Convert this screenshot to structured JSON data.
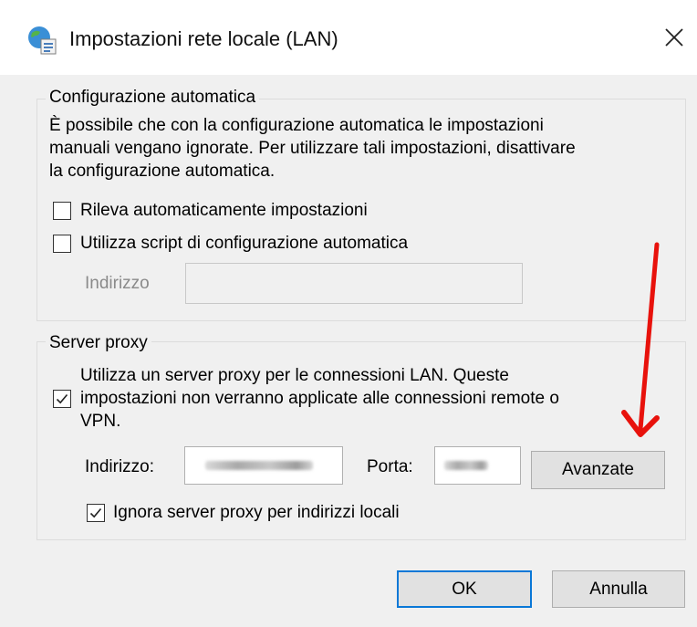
{
  "window": {
    "title": "Impostazioni rete locale (LAN)",
    "icon": "network-globe-icon",
    "close_glyph": "✕"
  },
  "auto_config": {
    "legend": "Configurazione automatica",
    "description_lines": [
      "È possibile che con la configurazione automatica le impostazioni",
      "manuali vengano ignorate. Per utilizzare tali impostazioni, disattivare",
      "la configurazione automatica."
    ],
    "detect_label": "Rileva automaticamente impostazioni",
    "detect_checked": false,
    "script_label": "Utilizza script di configurazione automatica",
    "script_checked": false,
    "address_label": "Indirizzo",
    "address_value": ""
  },
  "proxy": {
    "legend": "Server proxy",
    "use_proxy_lines": [
      "Utilizza un server proxy per le connessioni LAN. Queste",
      "impostazioni non verranno applicate alle connessioni remote o",
      "VPN."
    ],
    "use_proxy_checked": true,
    "address_label": "Indirizzo:",
    "port_label": "Porta:",
    "advanced_label": "Avanzate",
    "bypass_label": "Ignora server proxy per indirizzi locali",
    "bypass_checked": true
  },
  "buttons": {
    "ok_label": "OK",
    "cancel_label": "Annulla"
  },
  "colors": {
    "accent": "#0a78d7",
    "annotation_arrow": "#e8120c",
    "dialog_background": "#f0f0f0"
  }
}
